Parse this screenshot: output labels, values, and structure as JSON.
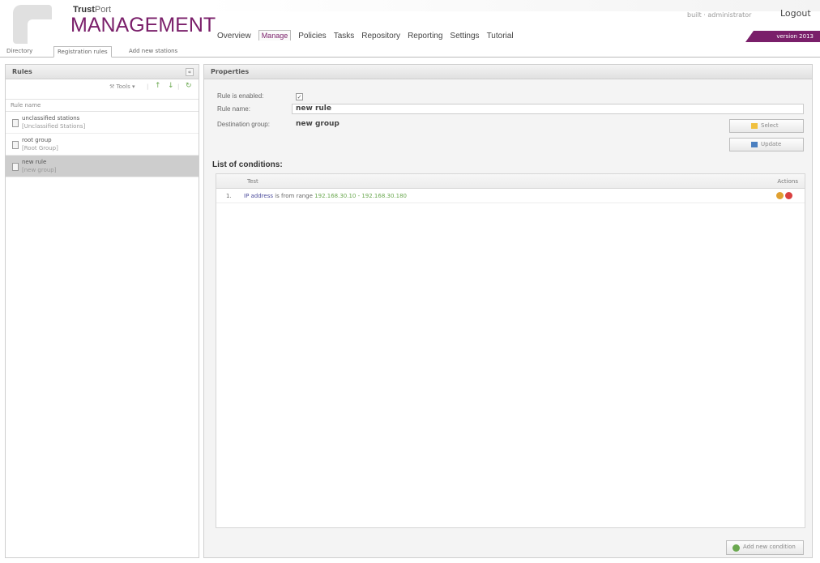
{
  "header": {
    "brand_small_bold": "Trust",
    "brand_small_rest": "Port",
    "brand_big": "MANAGEMENT",
    "user_info": "built · administrator",
    "logout": "Logout",
    "version": "version 2013"
  },
  "nav": {
    "items": [
      "Overview",
      "Manage",
      "Policies",
      "Tasks",
      "Repository",
      "Reporting",
      "Settings",
      "Tutorial"
    ],
    "active": "Manage"
  },
  "subtabs": [
    "Directory",
    "Registration rules",
    "Add new stations"
  ],
  "rules_panel": {
    "title": "Rules",
    "collapse": "«",
    "tools_label": "Tools ▾",
    "column_header": "Rule name",
    "items": [
      {
        "name": "unclassified stations",
        "group": "[Unclassified Stations]"
      },
      {
        "name": "root group",
        "group": "[Root Group]"
      },
      {
        "name": "new rule",
        "group": "[new group]"
      }
    ]
  },
  "properties": {
    "title": "Properties",
    "enabled_label": "Rule is enabled:",
    "enabled_check": "✓",
    "name_label": "Rule name:",
    "name_value": "new rule",
    "dest_label": "Destination group:",
    "dest_value": "new group",
    "select_button": "Select",
    "update_button": "Update",
    "list_title": "List of conditions:",
    "table_headers": {
      "test": "Test",
      "actions": "Actions"
    },
    "conditions": [
      {
        "num": "1.",
        "field": "IP address",
        "op": " is from range ",
        "value": "192.168.30.10 - 192.168.30.180"
      }
    ],
    "add_button": "Add new condition"
  },
  "colors": {
    "brand": "#7a1f6a",
    "accent_green": "#6aa84f",
    "field_blue": "#4b4b9b"
  }
}
